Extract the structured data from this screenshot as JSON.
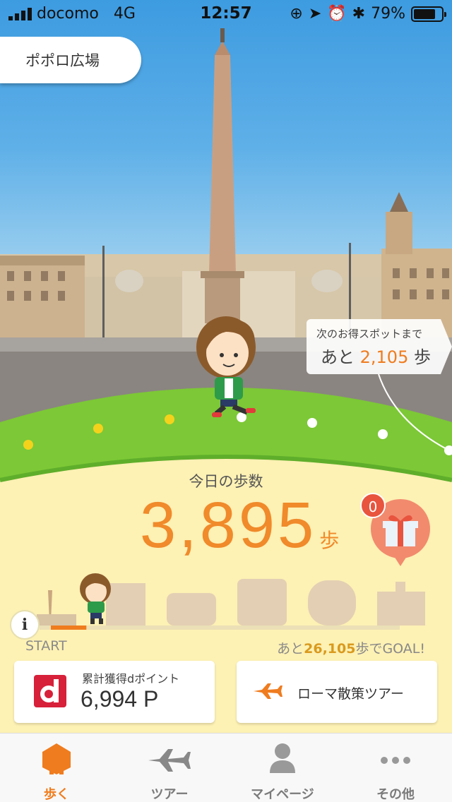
{
  "status_bar": {
    "carrier": "docomo",
    "network": "4G",
    "time": "12:57",
    "battery_percent": "79%",
    "battery_level": 0.79
  },
  "location": {
    "name": "ポポロ広場"
  },
  "next_spot": {
    "label": "次のお得スポットまで",
    "prefix": "あと",
    "steps": "2,105",
    "unit": "歩"
  },
  "today": {
    "label": "今日の歩数",
    "steps": "3,895",
    "unit": "歩"
  },
  "gift": {
    "badge_count": "0"
  },
  "progress": {
    "start_label": "START",
    "goal_prefix": "あと",
    "goal_steps": "26,105",
    "goal_suffix": "歩でGOAL!",
    "info_label": "i",
    "fraction": 0.13
  },
  "cards": {
    "points": {
      "label": "累計獲得dポイント",
      "value": "6,994 P"
    },
    "tour": {
      "label": "ローマ散策ツアー"
    }
  },
  "tabs": [
    {
      "label": "歩く",
      "icon": "walk-hexagon-icon",
      "active": true
    },
    {
      "label": "ツアー",
      "icon": "airplane-icon",
      "active": false
    },
    {
      "label": "マイページ",
      "icon": "person-icon",
      "active": false
    },
    {
      "label": "その他",
      "icon": "more-dots-icon",
      "active": false
    }
  ],
  "colors": {
    "accent": "#ef7c1e",
    "grass": "#7cc836",
    "panel": "#fdf1b4",
    "d_logo": "#d7203a"
  }
}
